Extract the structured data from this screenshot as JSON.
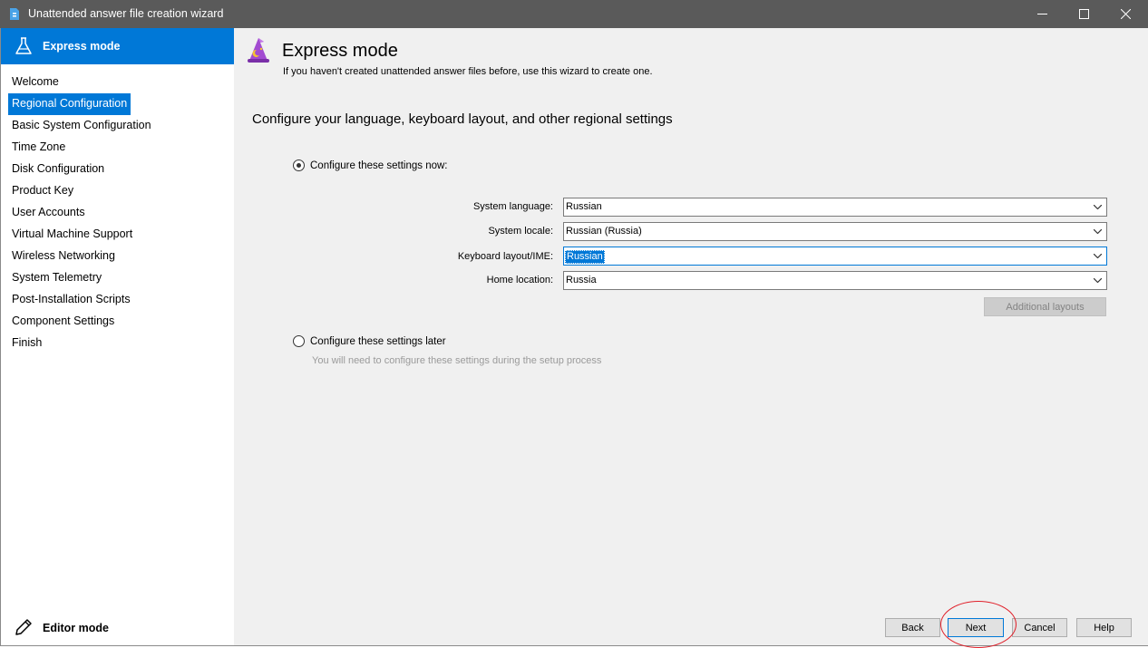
{
  "window": {
    "title": "Unattended answer file creation wizard",
    "controls": [
      "minimize",
      "maximize",
      "close"
    ]
  },
  "sidebar": {
    "header_label": "Express mode",
    "items": [
      {
        "label": "Welcome",
        "active": false
      },
      {
        "label": "Regional Configuration",
        "active": true
      },
      {
        "label": "Basic System Configuration",
        "active": false
      },
      {
        "label": "Time Zone",
        "active": false
      },
      {
        "label": "Disk Configuration",
        "active": false
      },
      {
        "label": "Product Key",
        "active": false
      },
      {
        "label": "User Accounts",
        "active": false
      },
      {
        "label": "Virtual Machine Support",
        "active": false
      },
      {
        "label": "Wireless Networking",
        "active": false
      },
      {
        "label": "System Telemetry",
        "active": false
      },
      {
        "label": "Post-Installation Scripts",
        "active": false
      },
      {
        "label": "Component Settings",
        "active": false
      },
      {
        "label": "Finish",
        "active": false
      }
    ],
    "editor_mode_label": "Editor mode"
  },
  "main": {
    "title": "Express mode",
    "subtitle": "If you haven't created unattended answer files before, use this wizard to create one.",
    "section_heading": "Configure your language, keyboard layout, and other regional settings",
    "option_now": {
      "label": "Configure these settings now:",
      "checked": true
    },
    "fields": {
      "system_language": {
        "label": "System language:",
        "value": "Russian"
      },
      "system_locale": {
        "label": "System locale:",
        "value": "Russian (Russia)"
      },
      "keyboard_layout": {
        "label": "Keyboard layout/IME:",
        "value": "Russian"
      },
      "home_location": {
        "label": "Home location:",
        "value": "Russia"
      }
    },
    "additional_layouts_label": "Additional layouts",
    "option_later": {
      "label": "Configure these settings later",
      "checked": false
    },
    "later_note": "You will need to configure these settings during the setup process"
  },
  "footer": {
    "back_label": "Back",
    "next_label": "Next",
    "cancel_label": "Cancel",
    "help_label": "Help"
  },
  "colors": {
    "accent": "#0078d7",
    "titlebar": "#5a5a5a",
    "content_bg": "#f0f0f0",
    "annotation": "#e0202a"
  }
}
